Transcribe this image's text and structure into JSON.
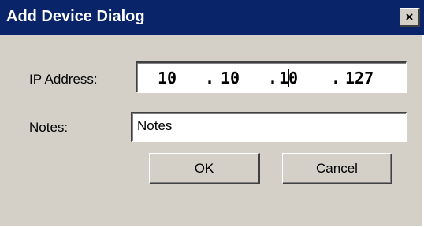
{
  "window": {
    "title": "Add Device Dialog",
    "close_glyph": "×",
    "close_icon": "close-icon"
  },
  "form": {
    "ip_label": "IP Address:",
    "ip_octets": [
      "10",
      "10",
      "10",
      "127"
    ],
    "ip_separator": ".",
    "notes_label": "Notes:",
    "notes_value": "Notes"
  },
  "buttons": {
    "ok_label": "OK",
    "cancel_label": "Cancel"
  },
  "colors": {
    "titlebar": "#0a246a",
    "dialog_face": "#d4d0c8",
    "field_bg": "#ffffff"
  }
}
